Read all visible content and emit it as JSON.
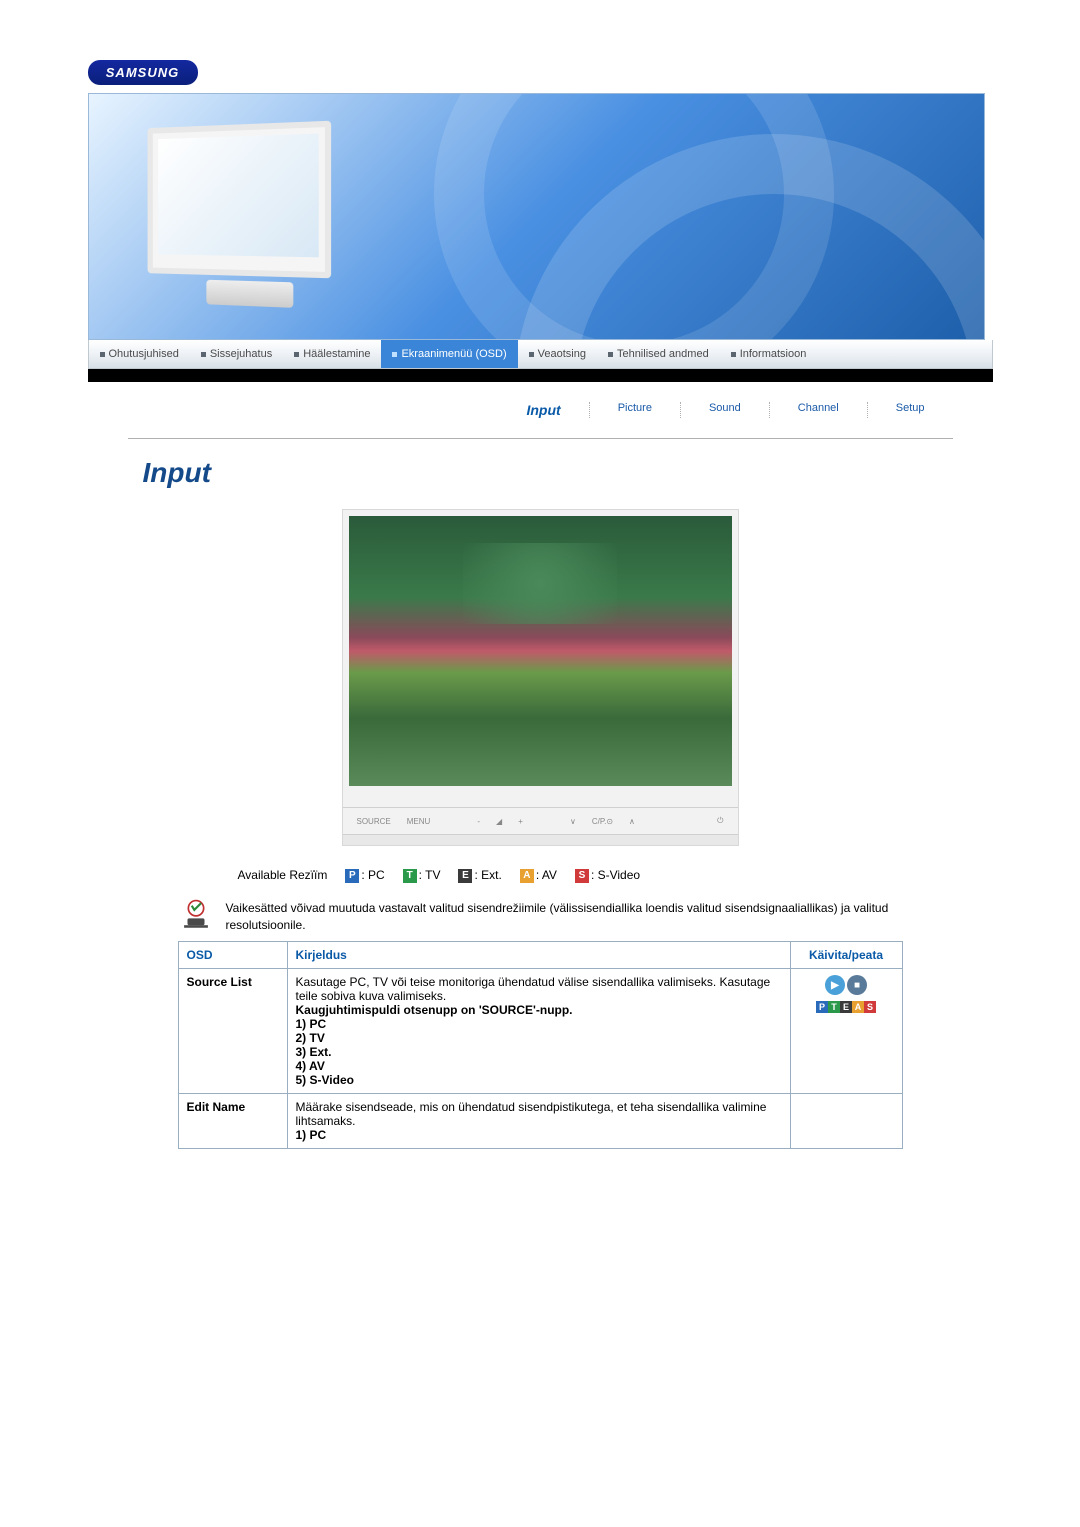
{
  "brand": "SAMSUNG",
  "nav": [
    {
      "label": "Ohutusjuhised",
      "active": false
    },
    {
      "label": "Sissejuhatus",
      "active": false
    },
    {
      "label": "Häälestamine",
      "active": false
    },
    {
      "label": "Ekraanimenüü (OSD)",
      "active": true
    },
    {
      "label": "Veaotsing",
      "active": false
    },
    {
      "label": "Tehnilised andmed",
      "active": false
    },
    {
      "label": "Informatsioon",
      "active": false
    }
  ],
  "subnav": [
    {
      "label": "Input",
      "current": true
    },
    {
      "label": "Picture",
      "current": false
    },
    {
      "label": "Sound",
      "current": false
    },
    {
      "label": "Channel",
      "current": false
    },
    {
      "label": "Setup",
      "current": false
    }
  ],
  "section_title": "Input",
  "monitor_controls": [
    "SOURCE",
    "MENU",
    "-",
    "",
    "+",
    "∨",
    "C/P.⊙",
    "∧",
    "⏻"
  ],
  "modes": {
    "label": "Available Rezïïm",
    "items": [
      {
        "badge": "P",
        "cls": "b-p",
        "text": ": PC"
      },
      {
        "badge": "T",
        "cls": "b-t",
        "text": ": TV"
      },
      {
        "badge": "E",
        "cls": "b-e",
        "text": ": Ext."
      },
      {
        "badge": "A",
        "cls": "b-a",
        "text": ": AV"
      },
      {
        "badge": "S",
        "cls": "b-s",
        "text": ": S-Video"
      }
    ]
  },
  "note": "Vaikesätted võivad muutuda vastavalt valitud sisendrežiimile (välissisendiallika loendis valitud sisendsignaaliallikas) ja valitud resolutsioonile.",
  "table": {
    "headers": {
      "osd": "OSD",
      "desc": "Kirjeldus",
      "launch": "Käivita/peata"
    },
    "rows": [
      {
        "osd": "Source List",
        "desc_intro": "Kasutage PC, TV või teise monitoriga ühendatud välise sisendallika valimiseks. Kasutage teile sobiva kuva valimiseks.",
        "desc_bold": "Kaugjuhtimispuldi otsenupp on 'SOURCE'-nupp.",
        "items": [
          "1) PC",
          "2) TV",
          "3) Ext.",
          "4) AV",
          "5) S-Video"
        ],
        "launch_badges": [
          "P",
          "T",
          "E",
          "A",
          "S"
        ]
      },
      {
        "osd": "Edit Name",
        "desc_intro": "Määrake sisendseade, mis on ühendatud sisendpistikutega, et teha sisendallika valimine lihtsamaks.",
        "desc_bold": "1) PC"
      }
    ]
  }
}
